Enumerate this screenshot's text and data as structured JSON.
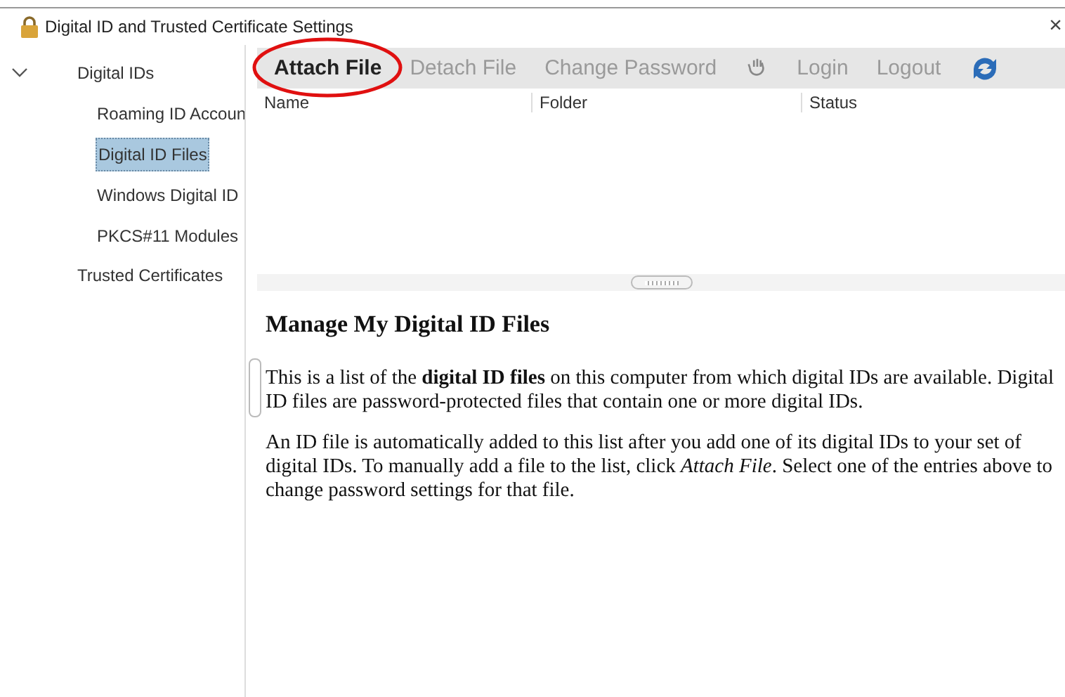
{
  "window": {
    "title": "Digital ID and Trusted Certificate Settings",
    "close": "×"
  },
  "tree": [
    {
      "label": "Digital IDs",
      "expanded": true,
      "selected": false,
      "children": [
        {
          "label": "Roaming ID Accoun",
          "selected": false
        },
        {
          "label": "Digital ID Files",
          "selected": true
        },
        {
          "label": "Windows Digital ID",
          "selected": false
        },
        {
          "label": "PKCS#11 Modules",
          "selected": false
        }
      ]
    },
    {
      "label": "Trusted Certificates",
      "selected": false
    }
  ],
  "toolbar": [
    {
      "kind": "text",
      "label": "Attach File",
      "disabled": false
    },
    {
      "kind": "text",
      "label": "Detach File",
      "disabled": true
    },
    {
      "kind": "text",
      "label": "Change Password",
      "disabled": true
    },
    {
      "kind": "timeout",
      "disabled": true
    },
    {
      "kind": "text",
      "label": "Login",
      "disabled": true
    },
    {
      "kind": "text",
      "label": "Logout",
      "disabled": true
    },
    {
      "kind": "refresh",
      "disabled": false
    }
  ],
  "table": {
    "columns": [
      "Name",
      "Folder",
      "Status"
    ]
  },
  "help": {
    "heading": "Manage My Digital ID Files",
    "paragraphs": [
      "This is a list of the **digital ID files** on this computer from which digital IDs are available. Digital ID files are password-protected files that contain one or more digital IDs.",
      "An ID file is automatically added to this list after you add one of its digital IDs to your set of digital IDs. To manually add a file to the list, click *Attach File*. Select one of the entries above to change password settings for that file."
    ]
  }
}
